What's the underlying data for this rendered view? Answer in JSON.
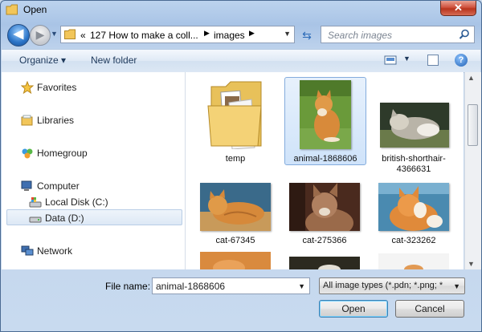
{
  "window": {
    "title": "Open",
    "close_glyph": "✕"
  },
  "nav": {
    "back_glyph": "◀",
    "forward_glyph": "▶",
    "breadcrumb": [
      "«",
      "127 How to make a coll...",
      "images"
    ],
    "search_placeholder": "Search images"
  },
  "toolbar": {
    "organize": "Organize",
    "new_folder": "New folder",
    "help": "?"
  },
  "navpane": {
    "items": [
      {
        "label": "Favorites",
        "icon": "star-icon"
      },
      {
        "label": "Libraries",
        "icon": "library-icon"
      },
      {
        "label": "Homegroup",
        "icon": "homegroup-icon"
      },
      {
        "label": "Computer",
        "icon": "computer-icon"
      },
      {
        "label": "Local Disk (C:)",
        "icon": "drive-icon"
      },
      {
        "label": "Data (D:)",
        "icon": "drive-icon"
      },
      {
        "label": "Network",
        "icon": "network-icon"
      }
    ],
    "selected": "Data (D:)"
  },
  "files": [
    {
      "name": "temp",
      "kind": "folder"
    },
    {
      "name": "animal-1868606",
      "kind": "image",
      "selected": true
    },
    {
      "name": "british-shorthair-4366631",
      "line1": "british-shorthair-",
      "line2": "4366631",
      "kind": "image"
    },
    {
      "name": "cat-67345",
      "kind": "image"
    },
    {
      "name": "cat-275366",
      "kind": "image"
    },
    {
      "name": "cat-323262",
      "kind": "image"
    }
  ],
  "footer": {
    "file_name_label": "File name:",
    "file_name_value": "animal-1868606",
    "file_type": "All image types (*.pdn; *.png; *",
    "open_label": "Open",
    "cancel_label": "Cancel"
  },
  "colors": {
    "accent": "#2b74c7",
    "selection": "#cfe3fa",
    "close": "#c8452d"
  }
}
